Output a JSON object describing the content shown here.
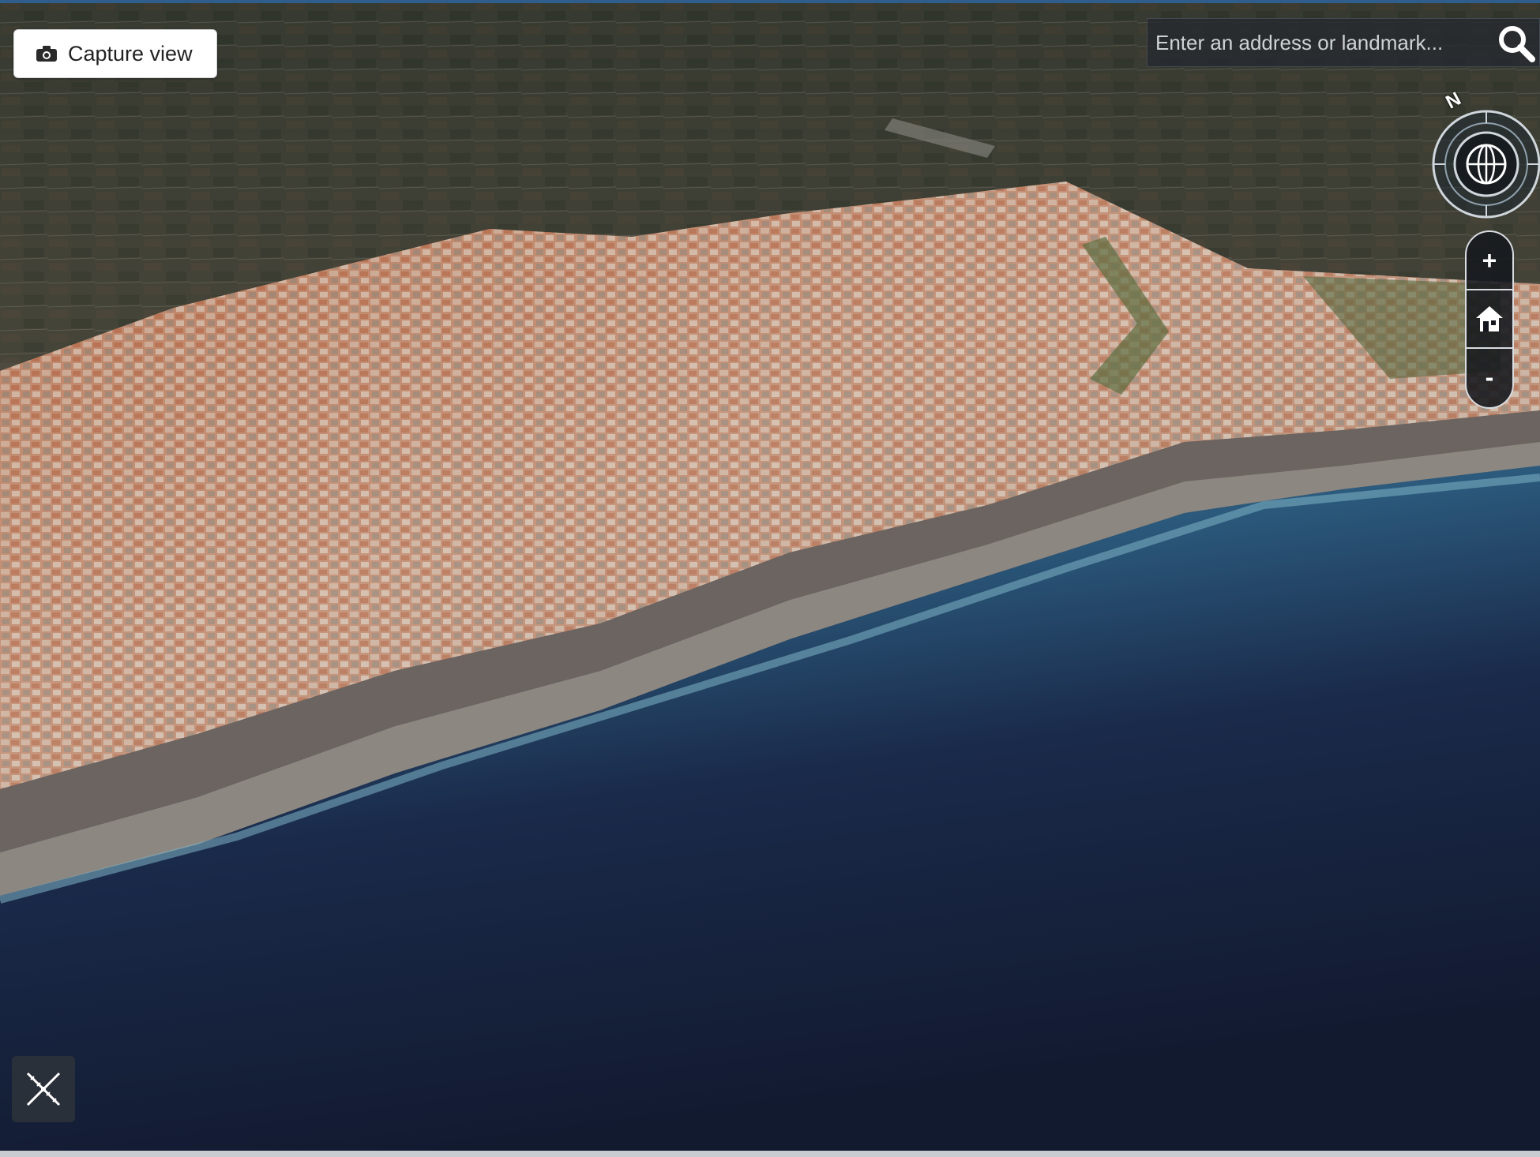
{
  "toolbar": {
    "capture_label": "Capture view",
    "capture_icon": "camera-icon"
  },
  "search": {
    "placeholder": "Enter an address or landmark...",
    "value": "",
    "icon": "search-icon"
  },
  "compass": {
    "north_label": "N",
    "icon": "globe-icon"
  },
  "zoom": {
    "zoom_in_label": "+",
    "home_icon": "home-icon",
    "zoom_out_label": "-"
  },
  "tools": {
    "measure_icon": "measure-icon"
  },
  "colors": {
    "sea_deep": "#141c33",
    "sea_shallow": "#3e7f9e",
    "roofs": "#c77a52",
    "land": "#3b3d33",
    "ui_dark": "#2c323a"
  }
}
